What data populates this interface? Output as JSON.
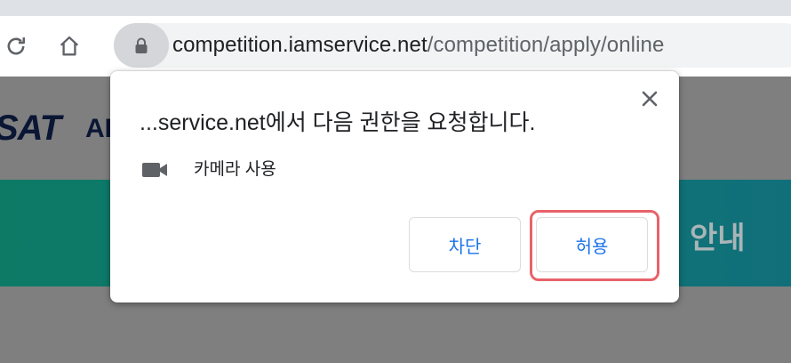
{
  "browser": {
    "url_host": "competition.iamservice.net",
    "url_path": "/competition/apply/online",
    "reload_icon": "reload-icon",
    "home_icon": "home-icon",
    "lock_icon": "lock-icon"
  },
  "page": {
    "logo_text": "SAT",
    "logo_after": "AI",
    "banner_text": "안내"
  },
  "dialog": {
    "title": "...service.net에서 다음 권한을 요청합니다.",
    "permission": {
      "icon": "camera-icon",
      "label": "카메라 사용"
    },
    "block_label": "차단",
    "allow_label": "허용",
    "close_icon": "close-icon"
  },
  "colors": {
    "accent": "#1a73e8",
    "highlight": "#e8626a",
    "banner": "#0e7773"
  }
}
